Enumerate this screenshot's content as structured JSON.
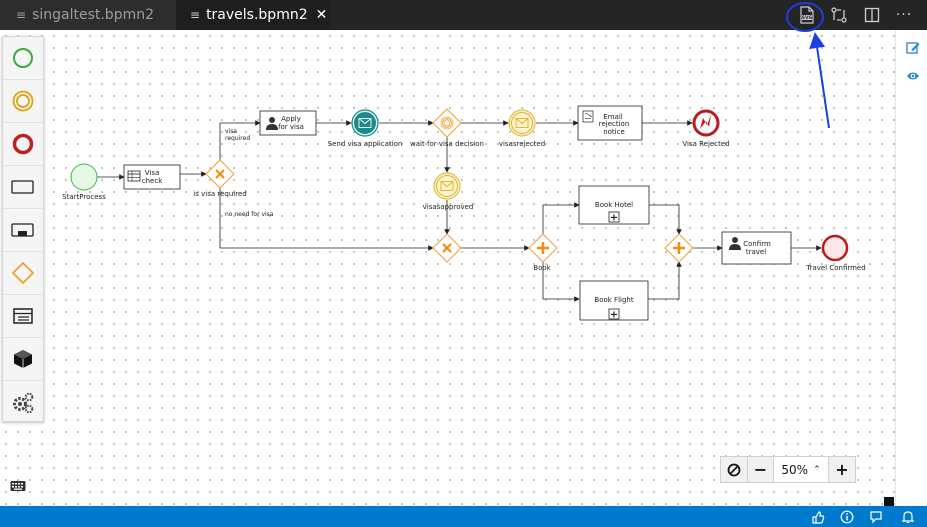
{
  "tabs": [
    {
      "label": "singaltest.bpmn2",
      "active": false
    },
    {
      "label": "travels.bpmn2",
      "active": true
    }
  ],
  "tab_close_glyph": "✕",
  "toolbar_actions": [
    {
      "icon": "svg-file-icon",
      "label": "SVG"
    },
    {
      "icon": "compare-changes-icon"
    },
    {
      "icon": "split-editor-icon"
    },
    {
      "icon": "more-actions-icon",
      "glyph": "···"
    }
  ],
  "palette": [
    {
      "icon": "start-event-icon"
    },
    {
      "icon": "intermediate-event-icon"
    },
    {
      "icon": "end-event-icon"
    },
    {
      "icon": "task-icon"
    },
    {
      "icon": "subprocess-icon"
    },
    {
      "icon": "gateway-icon"
    },
    {
      "icon": "data-object-icon"
    },
    {
      "icon": "custom-task-icon"
    },
    {
      "icon": "settings-gears-icon"
    }
  ],
  "diagram": {
    "start": {
      "label": "StartProcess"
    },
    "visa_check": {
      "line1": "Visa",
      "line2": "check"
    },
    "gw_visa": {
      "label": "is visa required"
    },
    "flow_visa_required": {
      "line1": "visa",
      "line2": "required"
    },
    "flow_no_visa": {
      "label": "no need for visa"
    },
    "apply_visa": {
      "line1": "Apply",
      "line2": "for visa"
    },
    "send_visa": {
      "label": "Send visa application"
    },
    "wait_decision": {
      "label": "wait for visa decision"
    },
    "visa_rejected_msg": {
      "label": "visasrejected"
    },
    "email_rejection": {
      "line1": "Email",
      "line2": "rejection",
      "line3": "notice"
    },
    "visa_rejected_end": {
      "label": "Visa Rejected"
    },
    "visa_approved_msg": {
      "label": "visasapproved"
    },
    "gw_book": {
      "label": "Book"
    },
    "book_hotel": {
      "label": "Book Hotel",
      "marker": "+"
    },
    "book_flight": {
      "label": "Book Flight",
      "marker": "+"
    },
    "confirm_travel": {
      "line1": "Confirm",
      "line2": "travel"
    },
    "travel_confirmed": {
      "label": "Travel Confirmed"
    }
  },
  "zoom": {
    "value": "50%",
    "caret": "⌃",
    "minus": "−",
    "plus": "+"
  },
  "colors": {
    "annotation": "#1a3fe0",
    "gateway": "#f0a030",
    "start_event": "#42b542",
    "end_event": "#b91c1c",
    "message_event": "#e0b020",
    "status_bar": "#007acc"
  }
}
